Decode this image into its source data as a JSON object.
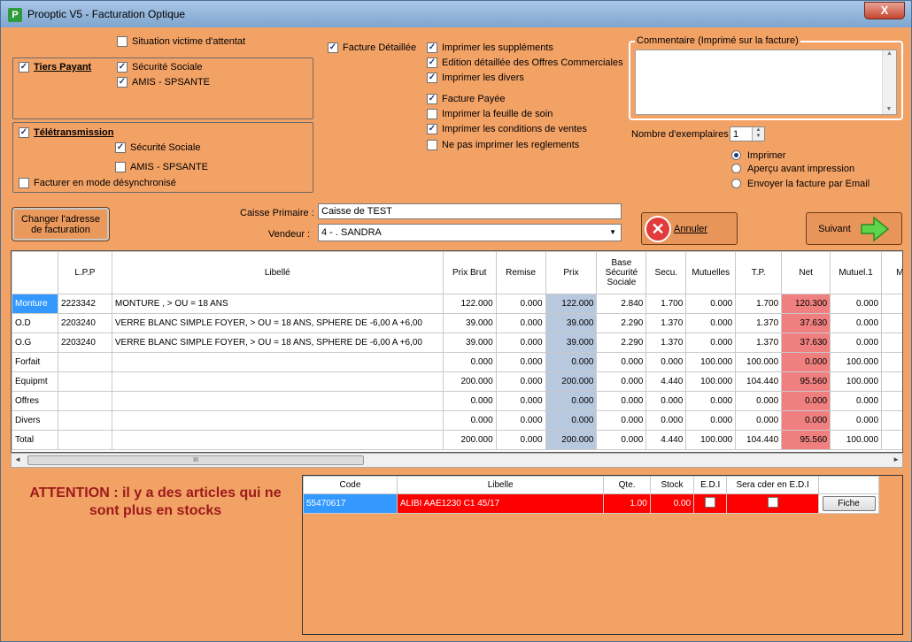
{
  "window": {
    "title": "Prooptic V5 - Facturation Optique",
    "close": "X",
    "app_icon": "P"
  },
  "options": {
    "situation_victime": {
      "label": "Situation victime d'attentat",
      "checked": false
    },
    "tiers_payant": {
      "label": "Tiers Payant",
      "checked": true
    },
    "tp_secu": {
      "label": "Sécurité Sociale",
      "checked": true
    },
    "tp_amis": {
      "label": "AMIS - SPSANTE",
      "checked": true
    },
    "teletransmission": {
      "label": "Télétransmission",
      "checked": true
    },
    "tt_secu": {
      "label": "Sécurité Sociale",
      "checked": true
    },
    "tt_amis": {
      "label": "AMIS - SPSANTE",
      "checked": false
    },
    "desync": {
      "label": "Facturer en mode désynchronisé",
      "checked": false
    },
    "facture_detaillee": {
      "label": "Facture Détaillée",
      "checked": true
    }
  },
  "print_options": [
    {
      "label": "Imprimer les suppléments",
      "checked": true
    },
    {
      "label": "Edition détaillée des Offres Commerciales",
      "checked": true
    },
    {
      "label": "Imprimer les divers",
      "checked": true
    },
    {
      "label": "Facture Payée",
      "checked": true
    },
    {
      "label": "Imprimer la feuille de soin",
      "checked": false
    },
    {
      "label": "Imprimer les conditions de ventes",
      "checked": true
    },
    {
      "label": "Ne pas imprimer les reglements",
      "checked": false
    }
  ],
  "comment": {
    "legend": "Commentaire (Imprimé sur la facture)",
    "value": ""
  },
  "copies": {
    "label": "Nombre d'exemplaires :",
    "value": "1"
  },
  "output": [
    {
      "label": "Imprimer",
      "selected": true
    },
    {
      "label": "Aperçu avant impression",
      "selected": false
    },
    {
      "label": "Envoyer la facture par Email",
      "selected": false
    }
  ],
  "change_address_label": "Changer l'adresse de facturation",
  "caisse": {
    "label": "Caisse Primaire :",
    "value": "Caisse de TEST"
  },
  "vendeur": {
    "label": "Vendeur :",
    "value": "4 - . SANDRA"
  },
  "annuler_label": "Annuler",
  "suivant_label": "Suivant",
  "grid": {
    "headers": [
      "",
      "L.P.P",
      "Libellé",
      "Prix Brut",
      "Remise",
      "Prix",
      "Base Sécurité Sociale",
      "Secu.",
      "Mutuelles",
      "T.P.",
      "Net",
      "Mutuel.1",
      "Mu"
    ],
    "rows": [
      [
        "Monture",
        "2223342",
        "MONTURE , > OU = 18 ANS",
        "122.000",
        "0.000",
        "122.000",
        "2.840",
        "1.700",
        "0.000",
        "1.700",
        "120.300",
        "0.000",
        ""
      ],
      [
        "O.D",
        "2203240",
        "VERRE BLANC SIMPLE FOYER, > OU = 18 ANS, SPHERE DE -6,00 A +6,00",
        "39.000",
        "0.000",
        "39.000",
        "2.290",
        "1.370",
        "0.000",
        "1.370",
        "37.630",
        "0.000",
        ""
      ],
      [
        "O.G",
        "2203240",
        "VERRE BLANC SIMPLE FOYER, > OU = 18 ANS, SPHERE DE -6,00 A +6,00",
        "39.000",
        "0.000",
        "39.000",
        "2.290",
        "1.370",
        "0.000",
        "1.370",
        "37.630",
        "0.000",
        ""
      ],
      [
        "Forfait",
        "",
        "",
        "0.000",
        "0.000",
        "0.000",
        "0.000",
        "0.000",
        "100.000",
        "100.000",
        "0.000",
        "100.000",
        ""
      ],
      [
        "Equipmt",
        "",
        "",
        "200.000",
        "0.000",
        "200.000",
        "0.000",
        "4.440",
        "100.000",
        "104.440",
        "95.560",
        "100.000",
        ""
      ],
      [
        "Offres",
        "",
        "",
        "0.000",
        "0.000",
        "0.000",
        "0.000",
        "0.000",
        "0.000",
        "0.000",
        "0.000",
        "0.000",
        ""
      ],
      [
        "Divers",
        "",
        "",
        "0.000",
        "0.000",
        "0.000",
        "0.000",
        "0.000",
        "0.000",
        "0.000",
        "0.000",
        "0.000",
        ""
      ],
      [
        "Total",
        "",
        "",
        "200.000",
        "0.000",
        "200.000",
        "0.000",
        "4.440",
        "100.000",
        "104.440",
        "95.560",
        "100.000",
        ""
      ]
    ]
  },
  "scroll_thumb": "III",
  "attention": "ATTENTION : il y a des articles qui ne sont plus en stocks",
  "stock": {
    "headers": [
      "Code",
      "Libelle",
      "Qte.",
      "Stock",
      "E.D.I",
      "Sera cder en E.D.I",
      ""
    ],
    "row": {
      "code": "55470617",
      "libelle": "ALIBI AAE1230 C1 45/17",
      "qte": "1.00",
      "stock": "0.00",
      "fiche": "Fiche"
    }
  }
}
